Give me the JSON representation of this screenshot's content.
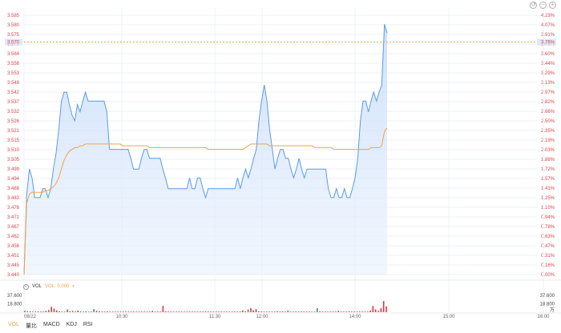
{
  "toolbar": {
    "icons": [
      "undo-icon",
      "zoom-out-icon",
      "zoom-in-icon"
    ],
    "glyphs": [
      "↺",
      "−",
      "+"
    ]
  },
  "colors": {
    "price_line": "#5b9be8",
    "avg_line": "#f0a34a",
    "up": "#e8343c",
    "down": "#2ea13f",
    "grid": "#eef1f6",
    "tick_text": "#e0414a",
    "neutral_text": "#666666"
  },
  "chart_data": [
    {
      "type": "line",
      "name": "intraday-time-sharing",
      "current_price_label": "3.570",
      "current_pct_label": "3.76%",
      "series": [
        {
          "name": "price",
          "values": [
            3.44,
            3.485,
            3.499,
            3.494,
            3.483,
            3.483,
            3.483,
            3.488,
            3.488,
            3.483,
            3.488,
            3.499,
            3.508,
            3.521,
            3.537,
            3.542,
            3.542,
            3.535,
            3.529,
            3.526,
            3.535,
            3.531,
            3.537,
            3.542,
            3.537,
            3.537,
            3.537,
            3.537,
            3.537,
            3.537,
            3.537,
            3.531,
            3.51,
            3.51,
            3.51,
            3.51,
            3.51,
            3.51,
            3.51,
            3.51,
            3.505,
            3.499,
            3.499,
            3.499,
            3.505,
            3.51,
            3.51,
            3.505,
            3.505,
            3.505,
            3.505,
            3.505,
            3.499,
            3.494,
            3.488,
            3.488,
            3.488,
            3.488,
            3.488,
            3.488,
            3.488,
            3.488,
            3.494,
            3.488,
            3.488,
            3.494,
            3.494,
            3.488,
            3.483,
            3.488,
            3.488,
            3.488,
            3.488,
            3.488,
            3.488,
            3.488,
            3.488,
            3.488,
            3.488,
            3.488,
            3.494,
            3.488,
            3.494,
            3.499,
            3.494,
            3.499,
            3.505,
            3.51,
            3.526,
            3.537,
            3.546,
            3.537,
            3.521,
            3.51,
            3.499,
            3.505,
            3.51,
            3.51,
            3.505,
            3.505,
            3.499,
            3.494,
            3.499,
            3.505,
            3.499,
            3.494,
            3.499,
            3.499,
            3.499,
            3.499,
            3.499,
            3.499,
            3.499,
            3.499,
            3.488,
            3.483,
            3.483,
            3.488,
            3.483,
            3.483,
            3.488,
            3.483,
            3.483,
            3.488,
            3.494,
            3.505,
            3.526,
            3.537,
            3.537,
            3.531,
            3.537,
            3.542,
            3.537,
            3.542,
            3.546,
            3.58,
            3.575
          ]
        },
        {
          "name": "average",
          "values": [
            3.44,
            3.48,
            3.485,
            3.486,
            3.486,
            3.486,
            3.486,
            3.486,
            3.487,
            3.487,
            3.488,
            3.489,
            3.491,
            3.494,
            3.499,
            3.504,
            3.507,
            3.509,
            3.51,
            3.511,
            3.511,
            3.512,
            3.512,
            3.513,
            3.513,
            3.513,
            3.513,
            3.513,
            3.513,
            3.513,
            3.513,
            3.513,
            3.513,
            3.513,
            3.513,
            3.513,
            3.513,
            3.512,
            3.512,
            3.512,
            3.512,
            3.512,
            3.512,
            3.512,
            3.512,
            3.512,
            3.512,
            3.511,
            3.511,
            3.511,
            3.511,
            3.511,
            3.511,
            3.511,
            3.511,
            3.511,
            3.511,
            3.511,
            3.511,
            3.511,
            3.511,
            3.511,
            3.511,
            3.511,
            3.511,
            3.511,
            3.511,
            3.511,
            3.511,
            3.51,
            3.51,
            3.51,
            3.51,
            3.51,
            3.51,
            3.51,
            3.51,
            3.51,
            3.51,
            3.51,
            3.51,
            3.51,
            3.51,
            3.511,
            3.512,
            3.513,
            3.513,
            3.513,
            3.513,
            3.513,
            3.513,
            3.513,
            3.512,
            3.512,
            3.512,
            3.512,
            3.512,
            3.512,
            3.512,
            3.512,
            3.512,
            3.512,
            3.512,
            3.512,
            3.512,
            3.512,
            3.512,
            3.512,
            3.512,
            3.511,
            3.511,
            3.511,
            3.511,
            3.511,
            3.511,
            3.511,
            3.51,
            3.51,
            3.51,
            3.51,
            3.51,
            3.51,
            3.51,
            3.51,
            3.51,
            3.51,
            3.51,
            3.51,
            3.51,
            3.51,
            3.511,
            3.511,
            3.511,
            3.511,
            3.512,
            3.52,
            3.522
          ]
        }
      ],
      "x_tick_labels": [
        "08/22",
        "10:30",
        "11:30",
        "12:00",
        "14:00",
        "15:00",
        "16:00"
      ],
      "y_ticks_left": [
        "3.585",
        "3.580",
        "3.575",
        "3.570",
        "3.564",
        "3.558",
        "3.553",
        "3.548",
        "3.542",
        "3.537",
        "3.532",
        "3.526",
        "3.521",
        "3.515",
        "3.510",
        "3.505",
        "3.499",
        "3.494",
        "3.488",
        "3.483",
        "3.478",
        "3.472",
        "3.467",
        "3.462",
        "3.456",
        "3.451",
        "3.445",
        "3.440"
      ],
      "y_ticks_right": [
        "4.23%",
        "4.07%",
        "3.91%",
        "3.76%",
        "3.60%",
        "3.44%",
        "3.29%",
        "3.13%",
        "2.97%",
        "2.82%",
        "2.66%",
        "2.50%",
        "2.35%",
        "2.19%",
        "2.03%",
        "1.88%",
        "1.72%",
        "1.57%",
        "1.41%",
        "1.25%",
        "1.10%",
        "0.94%",
        "0.78%",
        "0.63%",
        "0.47%",
        "0.31%",
        "0.16%",
        "0.00%"
      ],
      "ylim": [
        3.44,
        3.585
      ],
      "grid": true
    },
    {
      "type": "bar",
      "name": "volume",
      "y_ticks_left": [
        "37.600",
        "18.800"
      ],
      "y_ticks_right": [
        "37.600",
        "18.800",
        "万"
      ],
      "ylim": [
        0,
        37.6
      ],
      "values": [
        3,
        2,
        2,
        1,
        1,
        2,
        1,
        1,
        3,
        5,
        12,
        8,
        4,
        2,
        1,
        1,
        6,
        2,
        3,
        1,
        4,
        2,
        1,
        2,
        1,
        1,
        7,
        3,
        2,
        1,
        1,
        2,
        1,
        1,
        1,
        1,
        1,
        1,
        1,
        1,
        1,
        1,
        1,
        1,
        1,
        1,
        1,
        1,
        3,
        1,
        1,
        1,
        14,
        2,
        1,
        1,
        1,
        1,
        1,
        1,
        1,
        1,
        1,
        1,
        1,
        1,
        1,
        1,
        2,
        1,
        1,
        1,
        1,
        1,
        1,
        1,
        1,
        1,
        1,
        1,
        1,
        1,
        4,
        2,
        6,
        9,
        4,
        7,
        2,
        1,
        1,
        1,
        1,
        1,
        1,
        2,
        1,
        2,
        1,
        4,
        1,
        1,
        1,
        1,
        1,
        1,
        1,
        1,
        1,
        1,
        9,
        2,
        1,
        1,
        1,
        1,
        1,
        1,
        3,
        1,
        1,
        1,
        2,
        1,
        1,
        1,
        1,
        1,
        1,
        1,
        4,
        14,
        6,
        3,
        9,
        25,
        13
      ],
      "directions": [
        "u",
        "u",
        "d",
        "u",
        "u",
        "d",
        "u",
        "u",
        "u",
        "d",
        "u",
        "u",
        "u",
        "d",
        "u",
        "d",
        "u",
        "u",
        "d",
        "u",
        "u",
        "d",
        "u",
        "u",
        "d",
        "u",
        "d",
        "u",
        "u",
        "d",
        "u",
        "u",
        "d",
        "u",
        "u",
        "u",
        "u",
        "u",
        "u",
        "u",
        "u",
        "u",
        "u",
        "u",
        "u",
        "u",
        "u",
        "u",
        "u",
        "u",
        "u",
        "u",
        "u",
        "u",
        "u",
        "u",
        "u",
        "u",
        "u",
        "u",
        "u",
        "u",
        "u",
        "u",
        "u",
        "u",
        "u",
        "u",
        "u",
        "u",
        "u",
        "u",
        "u",
        "u",
        "u",
        "u",
        "u",
        "u",
        "u",
        "u",
        "u",
        "u",
        "u",
        "u",
        "d",
        "u",
        "u",
        "u",
        "u",
        "u",
        "u",
        "u",
        "u",
        "u",
        "u",
        "u",
        "u",
        "u",
        "u",
        "d",
        "u",
        "u",
        "u",
        "u",
        "u",
        "u",
        "u",
        "u",
        "u",
        "u",
        "d",
        "u",
        "u",
        "u",
        "u",
        "u",
        "u",
        "u",
        "u",
        "u",
        "u",
        "u",
        "u",
        "u",
        "u",
        "u",
        "u",
        "u",
        "u",
        "u",
        "u",
        "u",
        "u",
        "u",
        "u",
        "u",
        "u",
        "u"
      ]
    }
  ],
  "volume_panel": {
    "label": "VOL",
    "reading": "VOL: 0.000",
    "toggle": "◐",
    "arrow": "▾"
  },
  "bottom_tabs": [
    {
      "label": "VOL",
      "active": true
    },
    {
      "label": "量比",
      "active": false
    },
    {
      "label": "MACD",
      "active": false
    },
    {
      "label": "KDJ",
      "active": false
    },
    {
      "label": "RSI",
      "active": false
    }
  ]
}
